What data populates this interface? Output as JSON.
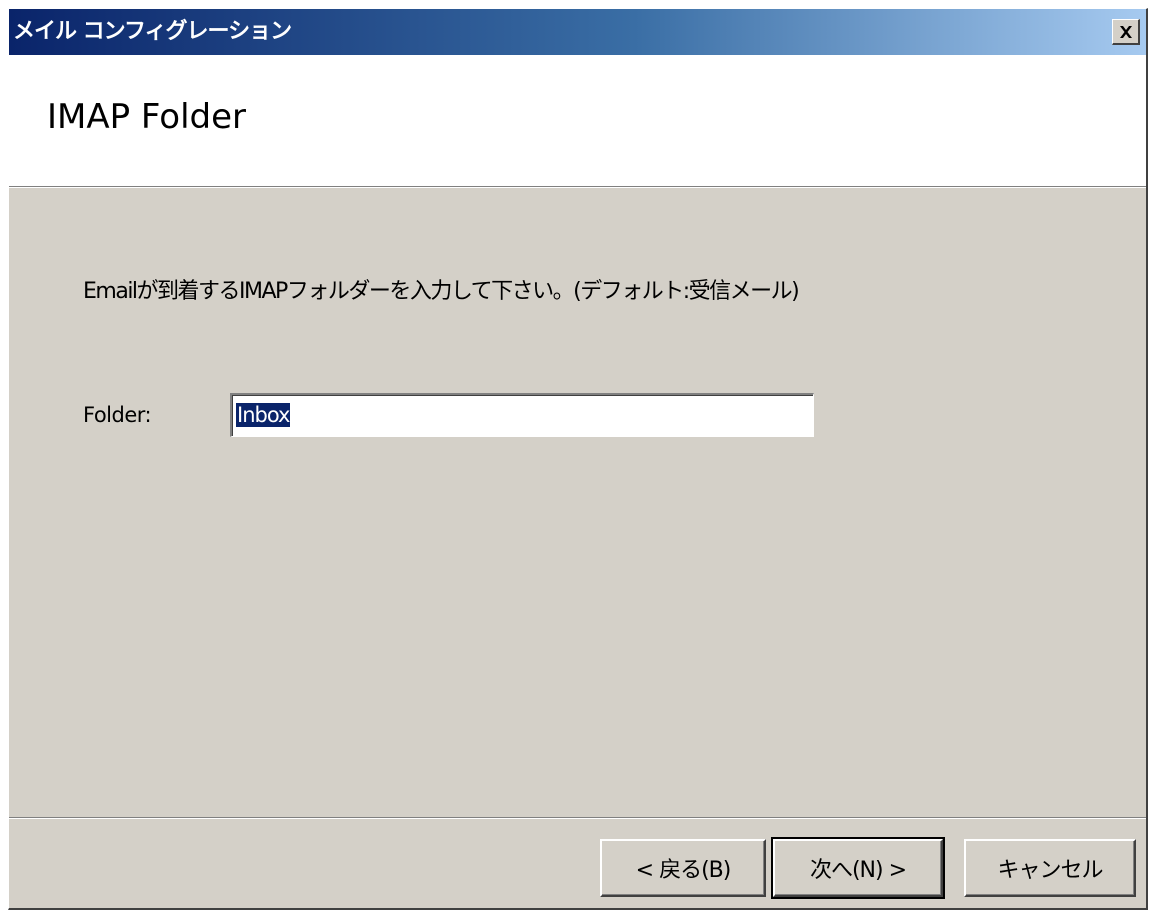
{
  "window": {
    "title": "メイル コンフィグレーション",
    "close_icon": "close-icon"
  },
  "header": {
    "title": "IMAP Folder"
  },
  "body": {
    "instruction": "Emailが到着するIMAPフォルダーを入力して下さい。(デフォルト:受信メール)",
    "folder_label": "Folder:",
    "folder_value": "Inbox"
  },
  "buttons": {
    "back": "< 戻る(B)",
    "next": "次へ(N) >",
    "cancel": "キャンセル"
  },
  "colors": {
    "titlebar_start": "#0a246a",
    "titlebar_end": "#a6caf0",
    "dialog_face": "#d4d0c8",
    "selection": "#0a246a"
  }
}
